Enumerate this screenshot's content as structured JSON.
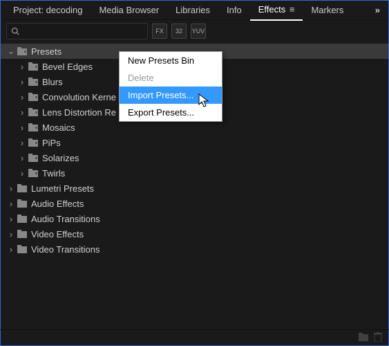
{
  "tabs": {
    "project": "Project: decoding",
    "media_browser": "Media Browser",
    "libraries": "Libraries",
    "info": "Info",
    "effects": "Effects",
    "markers": "Markers",
    "more": "»"
  },
  "search": {
    "placeholder": ""
  },
  "icon_buttons": {
    "a": "FX",
    "b": "32",
    "c": "YUV"
  },
  "tree": {
    "root": "Presets",
    "children": {
      "bevel": "Bevel Edges",
      "blurs": "Blurs",
      "conv": "Convolution Kerne",
      "lens": "Lens Distortion Re",
      "mosaics": "Mosaics",
      "pips": "PiPs",
      "solarizes": "Solarizes",
      "twirls": "Twirls"
    },
    "siblings": {
      "lumetri": "Lumetri Presets",
      "audio_fx": "Audio Effects",
      "audio_tr": "Audio Transitions",
      "video_fx": "Video Effects",
      "video_tr": "Video Transitions"
    }
  },
  "context": {
    "new_bin": "New Presets Bin",
    "delete": "Delete",
    "import": "Import Presets...",
    "export": "Export Presets..."
  }
}
